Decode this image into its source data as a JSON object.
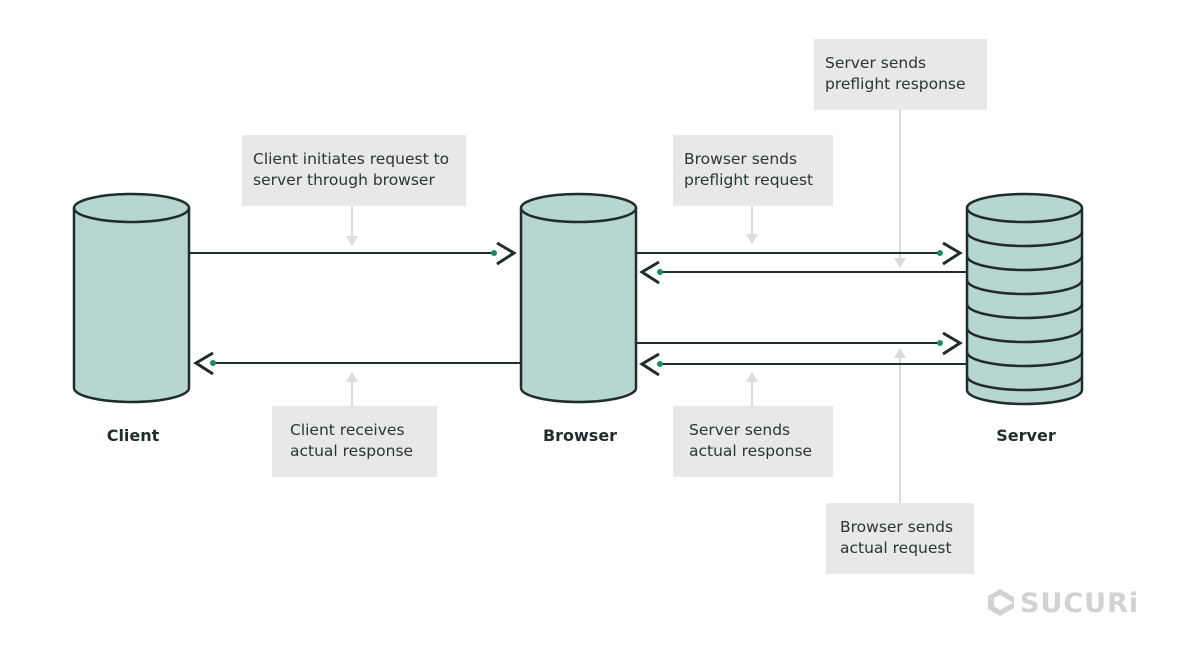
{
  "nodes": {
    "client": "Client",
    "browser": "Browser",
    "server": "Server"
  },
  "steps": {
    "client_initiates": "Client initiates request to server through browser",
    "browser_preflight": "Browser sends preflight request",
    "server_preflight": "Server sends preflight response",
    "client_receives": "Client receives actual response",
    "server_actual": "Server sends actual response",
    "browser_actual": "Browser sends actual request"
  },
  "logo": "SUCURi",
  "colors": {
    "cylinder_fill": "#b8d6d0",
    "stroke": "#1f2d2d",
    "dot": "#1a8a6e",
    "label_bg": "#e8e8e8",
    "pointer": "#dcdcdc"
  }
}
